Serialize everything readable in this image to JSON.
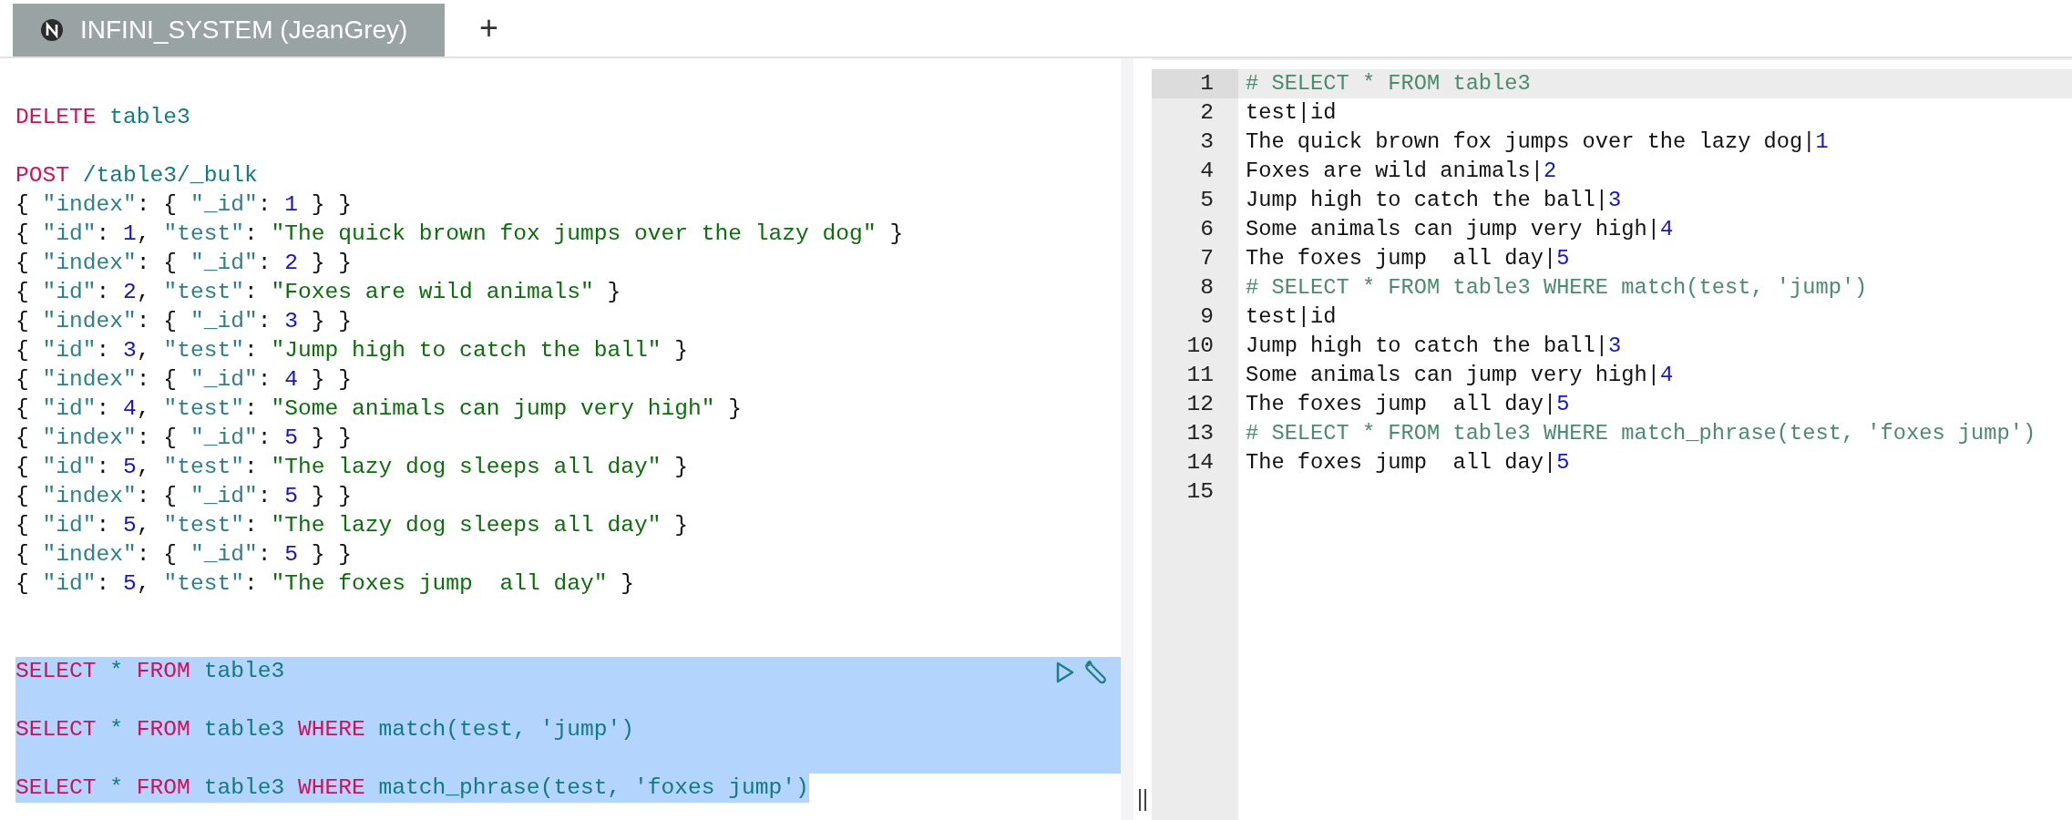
{
  "tabs": [
    {
      "label": "INFINI_SYSTEM (JeanGrey)",
      "selected": true
    }
  ],
  "new_tab": {
    "label": "+"
  },
  "editor": {
    "lines": [
      {
        "selected": false
      },
      {
        "selected": false,
        "tokens": [
          {
            "kind": "keyword",
            "text": "DELETE"
          },
          {
            "kind": "ident",
            "text": " table3"
          }
        ]
      },
      {
        "selected": false
      },
      {
        "selected": false,
        "tokens": [
          {
            "kind": "keyword",
            "text": "POST"
          },
          {
            "kind": "ident",
            "text": " /table3/_bulk"
          }
        ]
      },
      {
        "selected": false,
        "tokens": [
          {
            "kind": "punct",
            "text": "{ "
          },
          {
            "kind": "key",
            "text": "\"index\""
          },
          {
            "kind": "punct",
            "text": ": { "
          },
          {
            "kind": "key",
            "text": "\"_id\""
          },
          {
            "kind": "punct",
            "text": ": "
          },
          {
            "kind": "number",
            "text": "1"
          },
          {
            "kind": "punct",
            "text": " } }"
          }
        ]
      },
      {
        "selected": false,
        "tokens": [
          {
            "kind": "punct",
            "text": "{ "
          },
          {
            "kind": "key",
            "text": "\"id\""
          },
          {
            "kind": "punct",
            "text": ": "
          },
          {
            "kind": "number",
            "text": "1"
          },
          {
            "kind": "punct",
            "text": ", "
          },
          {
            "kind": "key",
            "text": "\"test\""
          },
          {
            "kind": "punct",
            "text": ": "
          },
          {
            "kind": "string",
            "text": "\"The quick brown fox jumps over the lazy dog\""
          },
          {
            "kind": "punct",
            "text": " }"
          }
        ]
      },
      {
        "selected": false,
        "tokens": [
          {
            "kind": "punct",
            "text": "{ "
          },
          {
            "kind": "key",
            "text": "\"index\""
          },
          {
            "kind": "punct",
            "text": ": { "
          },
          {
            "kind": "key",
            "text": "\"_id\""
          },
          {
            "kind": "punct",
            "text": ": "
          },
          {
            "kind": "number",
            "text": "2"
          },
          {
            "kind": "punct",
            "text": " } }"
          }
        ]
      },
      {
        "selected": false,
        "tokens": [
          {
            "kind": "punct",
            "text": "{ "
          },
          {
            "kind": "key",
            "text": "\"id\""
          },
          {
            "kind": "punct",
            "text": ": "
          },
          {
            "kind": "number",
            "text": "2"
          },
          {
            "kind": "punct",
            "text": ", "
          },
          {
            "kind": "key",
            "text": "\"test\""
          },
          {
            "kind": "punct",
            "text": ": "
          },
          {
            "kind": "string",
            "text": "\"Foxes are wild animals\""
          },
          {
            "kind": "punct",
            "text": " }"
          }
        ]
      },
      {
        "selected": false,
        "tokens": [
          {
            "kind": "punct",
            "text": "{ "
          },
          {
            "kind": "key",
            "text": "\"index\""
          },
          {
            "kind": "punct",
            "text": ": { "
          },
          {
            "kind": "key",
            "text": "\"_id\""
          },
          {
            "kind": "punct",
            "text": ": "
          },
          {
            "kind": "number",
            "text": "3"
          },
          {
            "kind": "punct",
            "text": " } }"
          }
        ]
      },
      {
        "selected": false,
        "tokens": [
          {
            "kind": "punct",
            "text": "{ "
          },
          {
            "kind": "key",
            "text": "\"id\""
          },
          {
            "kind": "punct",
            "text": ": "
          },
          {
            "kind": "number",
            "text": "3"
          },
          {
            "kind": "punct",
            "text": ", "
          },
          {
            "kind": "key",
            "text": "\"test\""
          },
          {
            "kind": "punct",
            "text": ": "
          },
          {
            "kind": "string",
            "text": "\"Jump high to catch the ball\""
          },
          {
            "kind": "punct",
            "text": " }"
          }
        ]
      },
      {
        "selected": false,
        "tokens": [
          {
            "kind": "punct",
            "text": "{ "
          },
          {
            "kind": "key",
            "text": "\"index\""
          },
          {
            "kind": "punct",
            "text": ": { "
          },
          {
            "kind": "key",
            "text": "\"_id\""
          },
          {
            "kind": "punct",
            "text": ": "
          },
          {
            "kind": "number",
            "text": "4"
          },
          {
            "kind": "punct",
            "text": " } }"
          }
        ]
      },
      {
        "selected": false,
        "tokens": [
          {
            "kind": "punct",
            "text": "{ "
          },
          {
            "kind": "key",
            "text": "\"id\""
          },
          {
            "kind": "punct",
            "text": ": "
          },
          {
            "kind": "number",
            "text": "4"
          },
          {
            "kind": "punct",
            "text": ", "
          },
          {
            "kind": "key",
            "text": "\"test\""
          },
          {
            "kind": "punct",
            "text": ": "
          },
          {
            "kind": "string",
            "text": "\"Some animals can jump very high\""
          },
          {
            "kind": "punct",
            "text": " }"
          }
        ]
      },
      {
        "selected": false,
        "tokens": [
          {
            "kind": "punct",
            "text": "{ "
          },
          {
            "kind": "key",
            "text": "\"index\""
          },
          {
            "kind": "punct",
            "text": ": { "
          },
          {
            "kind": "key",
            "text": "\"_id\""
          },
          {
            "kind": "punct",
            "text": ": "
          },
          {
            "kind": "number",
            "text": "5"
          },
          {
            "kind": "punct",
            "text": " } }"
          }
        ]
      },
      {
        "selected": false,
        "tokens": [
          {
            "kind": "punct",
            "text": "{ "
          },
          {
            "kind": "key",
            "text": "\"id\""
          },
          {
            "kind": "punct",
            "text": ": "
          },
          {
            "kind": "number",
            "text": "5"
          },
          {
            "kind": "punct",
            "text": ", "
          },
          {
            "kind": "key",
            "text": "\"test\""
          },
          {
            "kind": "punct",
            "text": ": "
          },
          {
            "kind": "string",
            "text": "\"The lazy dog sleeps all day\""
          },
          {
            "kind": "punct",
            "text": " }"
          }
        ]
      },
      {
        "selected": false,
        "tokens": [
          {
            "kind": "punct",
            "text": "{ "
          },
          {
            "kind": "key",
            "text": "\"index\""
          },
          {
            "kind": "punct",
            "text": ": { "
          },
          {
            "kind": "key",
            "text": "\"_id\""
          },
          {
            "kind": "punct",
            "text": ": "
          },
          {
            "kind": "number",
            "text": "5"
          },
          {
            "kind": "punct",
            "text": " } }"
          }
        ]
      },
      {
        "selected": false,
        "tokens": [
          {
            "kind": "punct",
            "text": "{ "
          },
          {
            "kind": "key",
            "text": "\"id\""
          },
          {
            "kind": "punct",
            "text": ": "
          },
          {
            "kind": "number",
            "text": "5"
          },
          {
            "kind": "punct",
            "text": ", "
          },
          {
            "kind": "key",
            "text": "\"test\""
          },
          {
            "kind": "punct",
            "text": ": "
          },
          {
            "kind": "string",
            "text": "\"The lazy dog sleeps all day\""
          },
          {
            "kind": "punct",
            "text": " }"
          }
        ]
      },
      {
        "selected": false,
        "tokens": [
          {
            "kind": "punct",
            "text": "{ "
          },
          {
            "kind": "key",
            "text": "\"index\""
          },
          {
            "kind": "punct",
            "text": ": { "
          },
          {
            "kind": "key",
            "text": "\"_id\""
          },
          {
            "kind": "punct",
            "text": ": "
          },
          {
            "kind": "number",
            "text": "5"
          },
          {
            "kind": "punct",
            "text": " } }"
          }
        ]
      },
      {
        "selected": false,
        "tokens": [
          {
            "kind": "punct",
            "text": "{ "
          },
          {
            "kind": "key",
            "text": "\"id\""
          },
          {
            "kind": "punct",
            "text": ": "
          },
          {
            "kind": "number",
            "text": "5"
          },
          {
            "kind": "punct",
            "text": ", "
          },
          {
            "kind": "key",
            "text": "\"test\""
          },
          {
            "kind": "punct",
            "text": ": "
          },
          {
            "kind": "string",
            "text": "\"The foxes jump  all day\""
          },
          {
            "kind": "punct",
            "text": " }"
          }
        ]
      },
      {
        "selected": false
      },
      {
        "selected": false
      },
      {
        "selected": true,
        "whole_line": true,
        "actions": [
          {
            "kind": "run"
          },
          {
            "kind": "settings"
          }
        ],
        "tokens": [
          {
            "kind": "keyword",
            "text": "SELECT"
          },
          {
            "kind": "ident",
            "text": " * "
          },
          {
            "kind": "keyword",
            "text": "FROM"
          },
          {
            "kind": "ident",
            "text": " table3"
          }
        ]
      },
      {
        "selected": true,
        "whole_line": true
      },
      {
        "selected": true,
        "whole_line": true,
        "tokens": [
          {
            "kind": "keyword",
            "text": "SELECT"
          },
          {
            "kind": "ident",
            "text": " * "
          },
          {
            "kind": "keyword",
            "text": "FROM"
          },
          {
            "kind": "ident",
            "text": " table3 "
          },
          {
            "kind": "keyword",
            "text": "WHERE"
          },
          {
            "kind": "ident",
            "text": " match(test, 'jump')"
          }
        ]
      },
      {
        "selected": true,
        "whole_line": true
      },
      {
        "selected": true,
        "whole_line": false,
        "tokens": [
          {
            "kind": "keyword",
            "text": "SELECT"
          },
          {
            "kind": "ident",
            "text": " * "
          },
          {
            "kind": "keyword",
            "text": "FROM"
          },
          {
            "kind": "ident",
            "text": " table3 "
          },
          {
            "kind": "keyword",
            "text": "WHERE"
          },
          {
            "kind": "ident",
            "text": " match_phrase(test, 'foxes jump')"
          }
        ]
      }
    ]
  },
  "output": {
    "lines": [
      {
        "number": "1",
        "active": true,
        "tokens": [
          {
            "kind": "comment",
            "text": "# SELECT * FROM table3"
          }
        ]
      },
      {
        "number": "2",
        "active": false,
        "tokens": [
          {
            "kind": "plain",
            "text": "test|id"
          }
        ]
      },
      {
        "number": "3",
        "active": false,
        "tokens": [
          {
            "kind": "plain",
            "text": "The quick brown fox jumps over the lazy dog|"
          },
          {
            "kind": "number",
            "text": "1"
          }
        ]
      },
      {
        "number": "4",
        "active": false,
        "tokens": [
          {
            "kind": "plain",
            "text": "Foxes are wild animals|"
          },
          {
            "kind": "number",
            "text": "2"
          }
        ]
      },
      {
        "number": "5",
        "active": false,
        "tokens": [
          {
            "kind": "plain",
            "text": "Jump high to catch the ball|"
          },
          {
            "kind": "number",
            "text": "3"
          }
        ]
      },
      {
        "number": "6",
        "active": false,
        "tokens": [
          {
            "kind": "plain",
            "text": "Some animals can jump very high|"
          },
          {
            "kind": "number",
            "text": "4"
          }
        ]
      },
      {
        "number": "7",
        "active": false,
        "tokens": [
          {
            "kind": "plain",
            "text": "The foxes jump  all day|"
          },
          {
            "kind": "number",
            "text": "5"
          }
        ]
      },
      {
        "number": "8",
        "active": false,
        "tokens": [
          {
            "kind": "comment",
            "text": "# SELECT * FROM table3 WHERE match(test, 'jump')"
          }
        ]
      },
      {
        "number": "9",
        "active": false,
        "tokens": [
          {
            "kind": "plain",
            "text": "test|id"
          }
        ]
      },
      {
        "number": "10",
        "active": false,
        "tokens": [
          {
            "kind": "plain",
            "text": "Jump high to catch the ball|"
          },
          {
            "kind": "number",
            "text": "3"
          }
        ]
      },
      {
        "number": "11",
        "active": false,
        "tokens": [
          {
            "kind": "plain",
            "text": "Some animals can jump very high|"
          },
          {
            "kind": "number",
            "text": "4"
          }
        ]
      },
      {
        "number": "12",
        "active": false,
        "tokens": [
          {
            "kind": "plain",
            "text": "The foxes jump  all day|"
          },
          {
            "kind": "number",
            "text": "5"
          }
        ]
      },
      {
        "number": "13",
        "active": false,
        "tokens": [
          {
            "kind": "comment",
            "text": "# SELECT * FROM table3 WHERE match_phrase(test, 'foxes jump')"
          }
        ]
      },
      {
        "number": "14",
        "active": false,
        "tokens": [
          {
            "kind": "plain",
            "text": "The foxes jump  all day|"
          },
          {
            "kind": "number",
            "text": "5"
          }
        ]
      },
      {
        "number": "15",
        "active": false
      }
    ]
  }
}
